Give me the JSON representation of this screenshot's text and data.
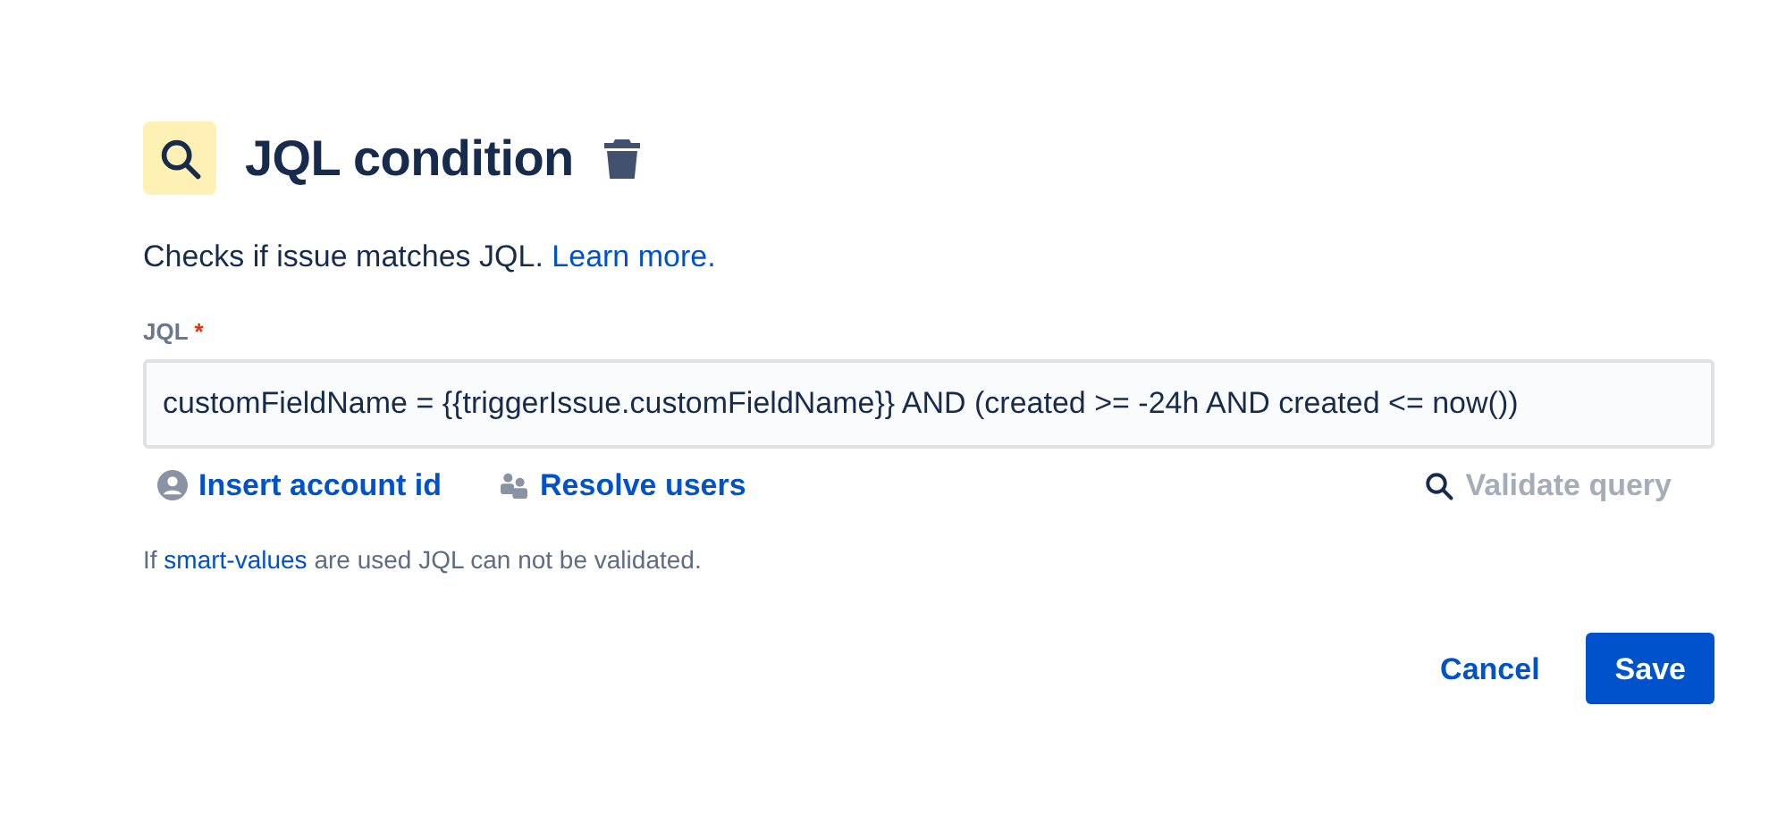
{
  "title": "JQL condition",
  "description": {
    "text": "Checks if issue matches JQL.",
    "link": "Learn more."
  },
  "field": {
    "label": "JQL",
    "required_mark": "*",
    "value": "customFieldName = {{triggerIssue.customFieldName}} AND (created >= -24h AND created <= now())"
  },
  "actions": [
    {
      "kind": "account",
      "label": "Insert account id",
      "disabled": false
    },
    {
      "kind": "users",
      "label": "Resolve users",
      "disabled": false
    },
    {
      "kind": "validate",
      "label": "Validate query",
      "disabled": true
    }
  ],
  "hint": {
    "before": "If",
    "link": "smart-values",
    "after": "are used JQL can not be validated."
  },
  "buttons": [
    {
      "kind": "link",
      "label": "Cancel"
    },
    {
      "kind": "primary",
      "label": "Save"
    }
  ]
}
